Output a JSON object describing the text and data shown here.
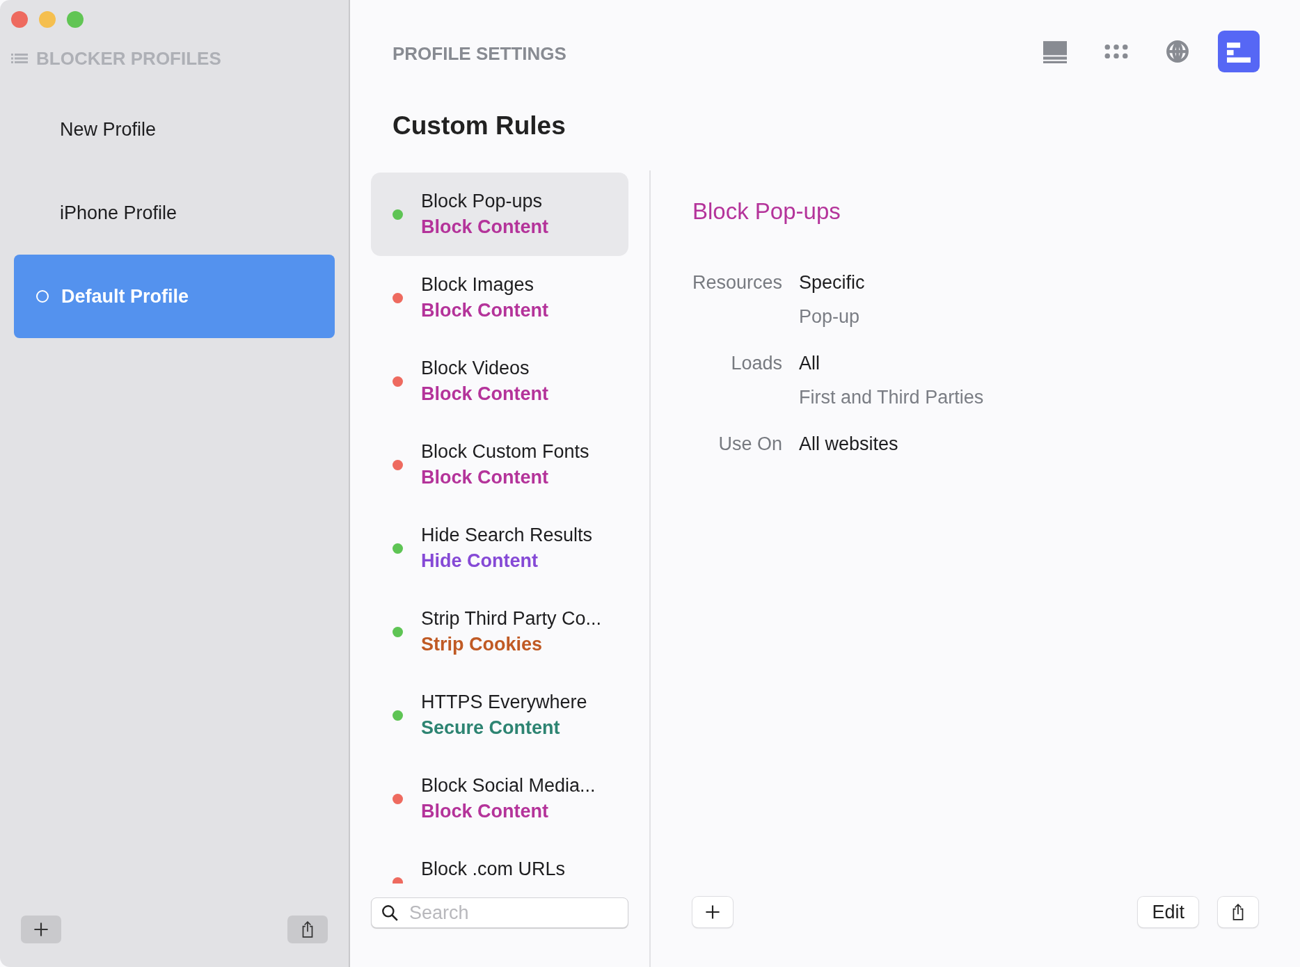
{
  "sidebar": {
    "title": "BLOCKER PROFILES",
    "items": [
      {
        "label": "New Profile",
        "selected": false
      },
      {
        "label": "iPhone Profile",
        "selected": false
      },
      {
        "label": "Default Profile",
        "selected": true
      }
    ]
  },
  "header": {
    "title": "PROFILE SETTINGS",
    "toolbar": [
      {
        "kind": "rows",
        "selected": false
      },
      {
        "kind": "dots",
        "selected": false
      },
      {
        "kind": "globe",
        "selected": false
      },
      {
        "kind": "outline",
        "selected": true
      }
    ]
  },
  "rules": {
    "title": "Custom Rules",
    "items": [
      {
        "name": "Block Pop-ups",
        "category": {
          "label": "Block Content",
          "color": "#b4339a"
        },
        "enabled": true,
        "selected": true
      },
      {
        "name": "Block Images",
        "category": {
          "label": "Block Content",
          "color": "#b4339a"
        },
        "enabled": false,
        "selected": false
      },
      {
        "name": "Block Videos",
        "category": {
          "label": "Block Content",
          "color": "#b4339a"
        },
        "enabled": false,
        "selected": false
      },
      {
        "name": "Block Custom Fonts",
        "category": {
          "label": "Block Content",
          "color": "#b4339a"
        },
        "enabled": false,
        "selected": false
      },
      {
        "name": "Hide Search Results",
        "category": {
          "label": "Hide Content",
          "color": "#8549d6"
        },
        "enabled": true,
        "selected": false
      },
      {
        "name": "Strip Third Party Co...",
        "category": {
          "label": "Strip Cookies",
          "color": "#c05a24"
        },
        "enabled": true,
        "selected": false
      },
      {
        "name": "HTTPS Everywhere",
        "category": {
          "label": "Secure Content",
          "color": "#2d8472"
        },
        "enabled": true,
        "selected": false
      },
      {
        "name": "Block Social Media...",
        "category": {
          "label": "Block Content",
          "color": "#b4339a"
        },
        "enabled": false,
        "selected": false
      },
      {
        "name": "Block .com URLs",
        "enabled": false,
        "selected": false
      }
    ],
    "search": {
      "placeholder": "Search"
    }
  },
  "detail": {
    "title": "Block Pop-ups",
    "fields": [
      {
        "label": "Resources",
        "value": "Specific",
        "note": "Pop-up"
      },
      {
        "label": "Loads",
        "value": "All",
        "note": "First and Third Parties"
      },
      {
        "label": "Use On",
        "value": "All websites"
      }
    ],
    "buttons": {
      "edit": "Edit"
    }
  }
}
